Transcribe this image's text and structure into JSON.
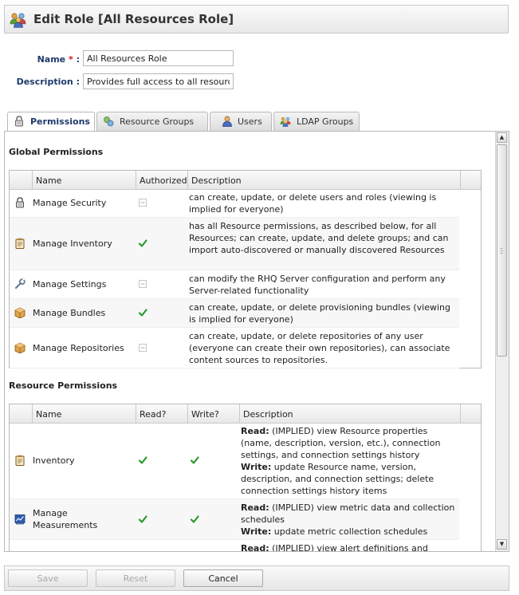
{
  "header": {
    "title": "Edit Role [All Resources Role]",
    "icon": "role-group-icon"
  },
  "form": {
    "name_label": "Name",
    "required_marker": "*",
    "name_colon": ":",
    "name_value": "All Resources Role",
    "description_label": "Description",
    "description_colon": ":",
    "description_value": "Provides full access to all resources"
  },
  "tabs": [
    {
      "label": "Permissions",
      "icon": "lock-icon",
      "active": true
    },
    {
      "label": "Resource Groups",
      "icon": "resource-group-icon",
      "active": false
    },
    {
      "label": "Users",
      "icon": "user-icon",
      "active": false
    },
    {
      "label": "LDAP Groups",
      "icon": "ldap-group-icon",
      "active": false
    }
  ],
  "global": {
    "title": "Global Permissions",
    "headers": {
      "name": "Name",
      "authorized": "Authorized",
      "description": "Description"
    },
    "rows": [
      {
        "name": "Manage Security",
        "icon": "lock-icon",
        "authorized": false,
        "description": "can create, update, or delete users and roles (viewing is implied for everyone)"
      },
      {
        "name": "Manage Inventory",
        "icon": "clipboard-icon",
        "authorized": true,
        "description": "has all Resource permissions, as described below, for all Resources; can create, update, and delete groups; and can import auto-discovered or manually discovered Resources"
      },
      {
        "name": "Manage Settings",
        "icon": "wrench-icon",
        "authorized": false,
        "description": "can modify the RHQ Server configuration and perform any Server-related functionality"
      },
      {
        "name": "Manage Bundles",
        "icon": "package-icon",
        "authorized": true,
        "description": "can create, update, or delete provisioning bundles (viewing is implied for everyone)"
      },
      {
        "name": "Manage Repositories",
        "icon": "package-icon",
        "authorized": false,
        "description": "can create, update, or delete repositories of any user (everyone can create their own repositories), can associate content sources to repositories."
      }
    ]
  },
  "resource": {
    "title": "Resource Permissions",
    "headers": {
      "name": "Name",
      "read": "Read?",
      "write": "Write?",
      "description": "Description"
    },
    "read_prefix": "Read:",
    "write_prefix": "Write:",
    "rows": [
      {
        "name": "Inventory",
        "icon": "clipboard-icon",
        "read": true,
        "write": true,
        "read_text": "(IMPLIED) view Resource properties (name, description, version, etc.), connection settings, and connection settings history",
        "write_text": "update Resource name, version, description, and connection settings; delete connection settings history items"
      },
      {
        "name": "Manage Measurements",
        "icon": "monitor-chart-icon",
        "read": true,
        "write": true,
        "read_text": "(IMPLIED) view metric data and collection schedules",
        "write_text": "update metric collection schedules"
      },
      {
        "name": "",
        "icon": "",
        "read": false,
        "write": false,
        "read_text": "(IMPLIED) view alert definitions and",
        "write_text": ""
      }
    ]
  },
  "buttons": {
    "save": "Save",
    "reset": "Reset",
    "cancel": "Cancel"
  },
  "colors": {
    "label_blue": "#1f3a6b",
    "required_red": "#dd1111",
    "check_green": "#2a9a2a"
  }
}
